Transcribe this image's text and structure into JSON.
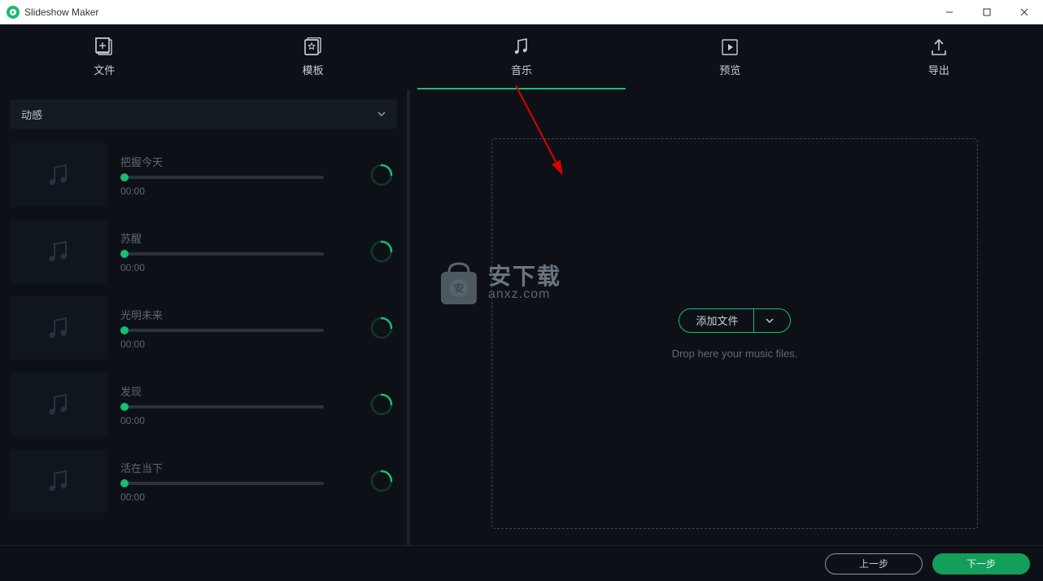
{
  "window": {
    "title": "Slideshow Maker"
  },
  "nav": {
    "file": "文件",
    "template": "模板",
    "music": "音乐",
    "preview": "预览",
    "export": "导出"
  },
  "sidebar": {
    "category": "动感",
    "tracks": [
      {
        "title": "把握今天",
        "time": "00:00"
      },
      {
        "title": "苏醒",
        "time": "00:00"
      },
      {
        "title": "光明未来",
        "time": "00:00"
      },
      {
        "title": "发现",
        "time": "00:00"
      },
      {
        "title": "活在当下",
        "time": "00:00"
      }
    ]
  },
  "dropzone": {
    "add_label": "添加文件",
    "hint": "Drop here your music files."
  },
  "footer": {
    "prev": "上一步",
    "next": "下一步"
  },
  "watermark": {
    "cn": "安下载",
    "en": "anxz.com"
  },
  "colors": {
    "accent": "#1abc6f",
    "bg": "#0d1117"
  }
}
